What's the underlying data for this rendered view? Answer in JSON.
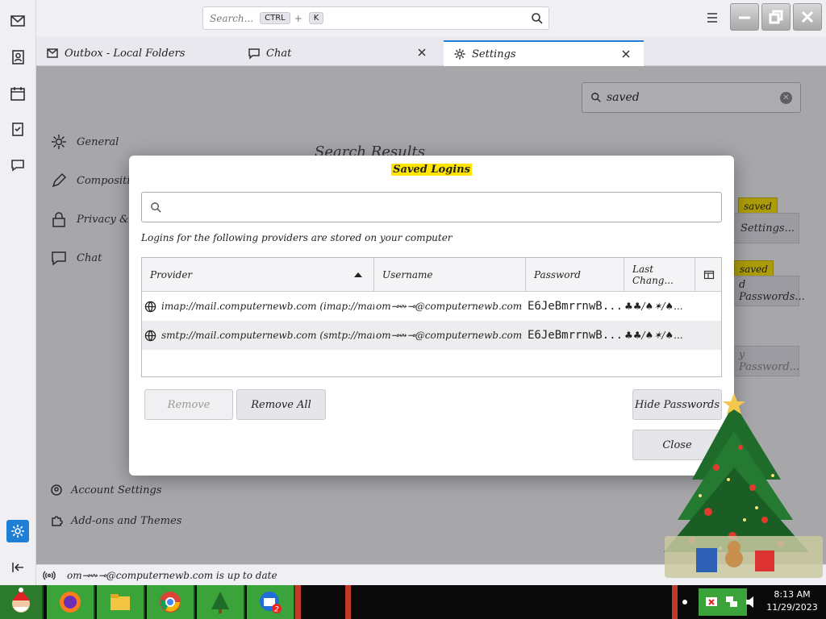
{
  "titlebar": {
    "search_placeholder": "Search...",
    "search_kbd_ctrl": "CTRL",
    "search_kbd_sep": "+",
    "search_kbd_k": "K"
  },
  "tabs": [
    {
      "label": "Outbox - Local Folders",
      "icon": "mail-folder-icon"
    },
    {
      "label": "Chat",
      "icon": "chat-icon"
    },
    {
      "label": "Settings",
      "icon": "gear-icon"
    }
  ],
  "settings": {
    "nav": [
      {
        "label": "General",
        "icon": "gear-icon"
      },
      {
        "label": "Composition",
        "icon": "pencil-icon"
      },
      {
        "label": "Privacy & Security",
        "icon": "lock-icon"
      },
      {
        "label": "Chat",
        "icon": "chat-icon"
      }
    ],
    "nav_bottom": [
      {
        "label": "Account Settings",
        "icon": "account-icon"
      },
      {
        "label": "Add-ons and Themes",
        "icon": "puzzle-icon"
      }
    ],
    "search_value": "saved",
    "results_heading": "Search Results",
    "badge_1": "saved",
    "badge_2": "saved",
    "bg_button_1": "Settings...",
    "bg_button_2": "d Passwords...",
    "bg_button_3": "y Password..."
  },
  "dialog": {
    "title": "Saved Logins",
    "filter_placeholder": "",
    "description": "Logins for the following providers are stored on your computer",
    "columns": {
      "provider": "Provider",
      "username": "Username",
      "password": "Password",
      "last_changed": "Last Chang..."
    },
    "rows": [
      {
        "provider": "imap://mail.computernewb.com (imap://mail.computerne...",
        "username": "om⊸↭⊸@computernewb.com",
        "password": "E6JeBmrrnwB...",
        "last_changed": "♣♣/♠✶/♠..."
      },
      {
        "provider": "smtp://mail.computernewb.com (smtp://mail.computerne...",
        "username": "om⊸↭⊸@computernewb.com",
        "password": "E6JeBmrrnwB...",
        "last_changed": "♣♣/♠✶/♠..."
      }
    ],
    "buttons": {
      "remove": "Remove",
      "remove_all": "Remove All",
      "hide_passwords": "Hide Passwords",
      "close": "Close"
    }
  },
  "statusbar": {
    "text": "om⊸↭⊸@computernewb.com is up to date"
  },
  "taskbar": {
    "time": "8:13 AM",
    "date": "11/29/2023",
    "badge_count": "2"
  },
  "colors": {
    "accent": "#1f7fd6",
    "highlight": "#ffe500",
    "taskbar_green": "#3aa33a"
  }
}
